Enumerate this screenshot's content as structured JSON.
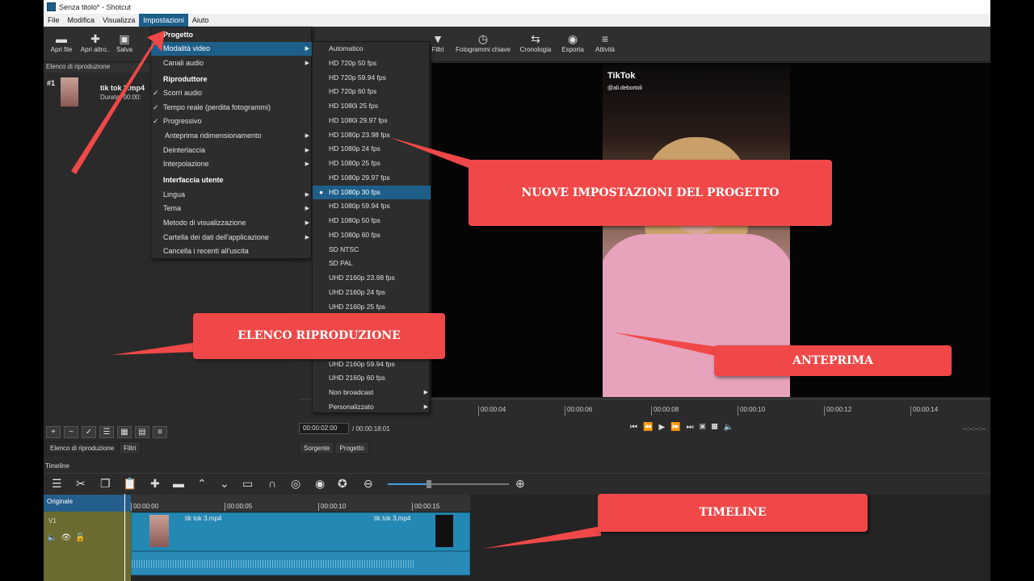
{
  "window": {
    "title": "Senza titolo* - Shotcut"
  },
  "menubar": {
    "items": [
      "File",
      "Modifica",
      "Visualizza",
      "Impostazioni",
      "Aiuto"
    ]
  },
  "toolbar": {
    "apri_file": "Apri file",
    "apri_altro": "Apri altro..",
    "salva": "Salva",
    "filtri": "Filtri",
    "fotogrammi": "Fotogrammi chiave",
    "cronologia": "Cronologia",
    "esporta": "Esporta",
    "attivita": "Attività"
  },
  "playlist": {
    "header": "Elenco di riproduzione",
    "item_num": "#1",
    "item_name": "tik tok 3.mp4",
    "item_duration": "Durata: 00:00:",
    "tab_playlist": "Elenco di riproduzione",
    "tab_filters": "Filtri"
  },
  "settings_menu": {
    "items": [
      {
        "label": "Progetto",
        "type": "header"
      },
      {
        "label": "Modalità video",
        "type": "sub",
        "selected": true
      },
      {
        "label": "Canali audio",
        "type": "sub"
      },
      {
        "label": "Riproduttore",
        "type": "header"
      },
      {
        "label": "Scorri audio",
        "type": "check"
      },
      {
        "label": "Tempo reale (perdita fotogrammi)",
        "type": "check"
      },
      {
        "label": "Progressivo",
        "type": "check"
      },
      {
        "label": "Anteprima ridimensionamento",
        "type": "sub"
      },
      {
        "label": "Deinterlaccia",
        "type": "sub"
      },
      {
        "label": "Interpolazione",
        "type": "sub"
      },
      {
        "label": "Interfaccia utente",
        "type": "header"
      },
      {
        "label": "Lingua",
        "type": "sub"
      },
      {
        "label": "Tema",
        "type": "sub"
      },
      {
        "label": "Metodo di visualizzazione",
        "type": "sub"
      },
      {
        "label": "Cartella dei dati dell'applicazione",
        "type": "sub"
      },
      {
        "label": "Cancella i recenti all'uscita",
        "type": "plain"
      }
    ]
  },
  "video_mode_menu": {
    "items": [
      {
        "label": "Automatico"
      },
      {
        "label": "HD 720p 50 fps"
      },
      {
        "label": "HD 720p 59.94 fps"
      },
      {
        "label": "HD 720p 60 fps"
      },
      {
        "label": "HD 1080i 25 fps"
      },
      {
        "label": "HD 1080i 29.97 fps"
      },
      {
        "label": "HD 1080p 23.98 fps"
      },
      {
        "label": "HD 1080p 24 fps"
      },
      {
        "label": "HD 1080p 25 fps"
      },
      {
        "label": "HD 1080p 29.97 fps"
      },
      {
        "label": "HD 1080p 30 fps",
        "selected": true
      },
      {
        "label": "HD 1080p 59.94 fps"
      },
      {
        "label": "HD 1080p 50 fps"
      },
      {
        "label": "HD 1080p 60 fps"
      },
      {
        "label": "SD NTSC"
      },
      {
        "label": "SD PAL"
      },
      {
        "label": "UHD 2160p 23.98 fps"
      },
      {
        "label": "UHD 2160p 24 fps"
      },
      {
        "label": "UHD 2160p 25 fps"
      },
      {
        "label": ""
      },
      {
        "label": ""
      },
      {
        "label": ""
      },
      {
        "label": "UHD 2160p 59.94 fps"
      },
      {
        "label": "UHD 2160p 60 fps"
      },
      {
        "label": "Non broadcast",
        "sub": true
      },
      {
        "label": "Personalizzato",
        "sub": true
      }
    ]
  },
  "preview": {
    "tiktok": "TikTok",
    "handle": "@ali.debortoli",
    "ruler": [
      "00:00:04",
      "00:00:06",
      "00:00:08",
      "00:00:10",
      "00:00:12",
      "00:00:14"
    ],
    "timecode": "00:00:02:00",
    "duration": "/ 00:00:18:01",
    "tab_source": "Sorgente",
    "tab_project": "Progetto",
    "right_tc": "--:--:--:--"
  },
  "timeline": {
    "label": "Timeline",
    "track_original": "Originale",
    "track_v1": "V1",
    "ruler": [
      "00:00:00",
      "00:00:05",
      "00:00:10",
      "00:00:15"
    ],
    "clip_name_1": "tik tok 3.mp4",
    "clip_name_2": "tik tok 3.mp4",
    "zoom": 0.33
  },
  "callouts": {
    "project": "NUOVE IMPOSTAZIONI DEL PROGETTO",
    "playlist": "ELENCO RIPRODUZIONE",
    "preview": "ANTEPRIMA",
    "timeline": "TIMELINE"
  },
  "colors": {
    "accent": "#1e5f8a",
    "callout": "#f04848",
    "clip": "#2488b4"
  }
}
